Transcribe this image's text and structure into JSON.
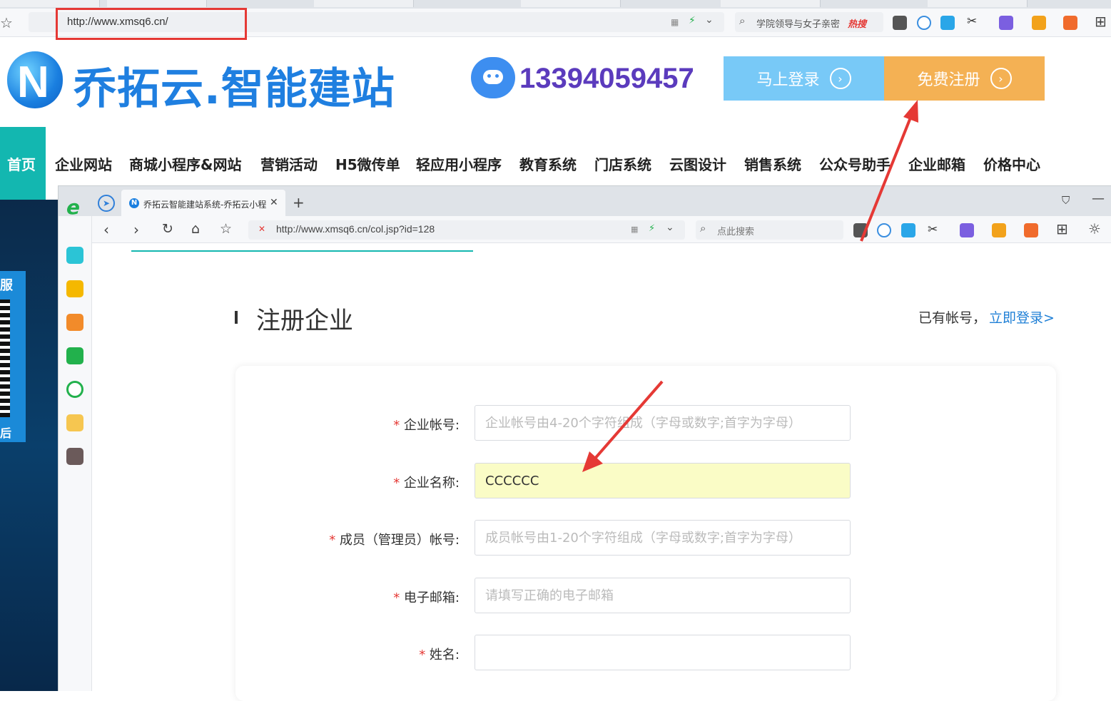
{
  "back_browser": {
    "url": "http://www.xmsq6.cn/",
    "search_hint": "学院领导与女子亲密",
    "search_hot": "热搜"
  },
  "header": {
    "logo_mark": "N",
    "logo_text": "乔拓云.智能建站",
    "phone": "13394059457",
    "login_button": "马上登录",
    "register_button": "免费注册"
  },
  "nav": {
    "home": "首页",
    "items": [
      "企业网站",
      "商城小程序&网站",
      "营销活动",
      "H5微传单",
      "轻应用小程序",
      "教育系统",
      "门店系统",
      "云图设计",
      "销售系统",
      "公众号助手",
      "企业邮箱",
      "价格中心"
    ]
  },
  "side_decor": {
    "char_top": "服",
    "char_bottom": "后"
  },
  "front_browser": {
    "tab_title": "乔拓云智能建站系统-乔拓云小程序",
    "url": "http://www.xmsq6.cn/col.jsp?id=128",
    "search_placeholder": "点此搜索"
  },
  "page": {
    "title": "注册企业",
    "have_account": "已有帐号，",
    "login_link": "立即登录>"
  },
  "form": {
    "required_mark": "*",
    "fields": [
      {
        "label": "企业帐号:",
        "value": "",
        "placeholder": "企业帐号由4-20个字符组成（字母或数字;首字为字母）"
      },
      {
        "label": "企业名称:",
        "value": "CCCCCC",
        "placeholder": ""
      },
      {
        "label": "成员（管理员）帐号:",
        "value": "",
        "placeholder": "成员帐号由1-20个字符组成（字母或数字;首字为字母）"
      },
      {
        "label": "电子邮箱:",
        "value": "",
        "placeholder": "请填写正确的电子邮箱"
      },
      {
        "label": "姓名:",
        "value": "",
        "placeholder": ""
      }
    ]
  },
  "colors": {
    "brand_blue": "#1f7fe0",
    "nav_teal": "#13b7b0",
    "login_bg": "#78c9f7",
    "register_bg": "#f4b154",
    "annotation_red": "#e53935",
    "autofill_yellow": "#fafcc6"
  }
}
